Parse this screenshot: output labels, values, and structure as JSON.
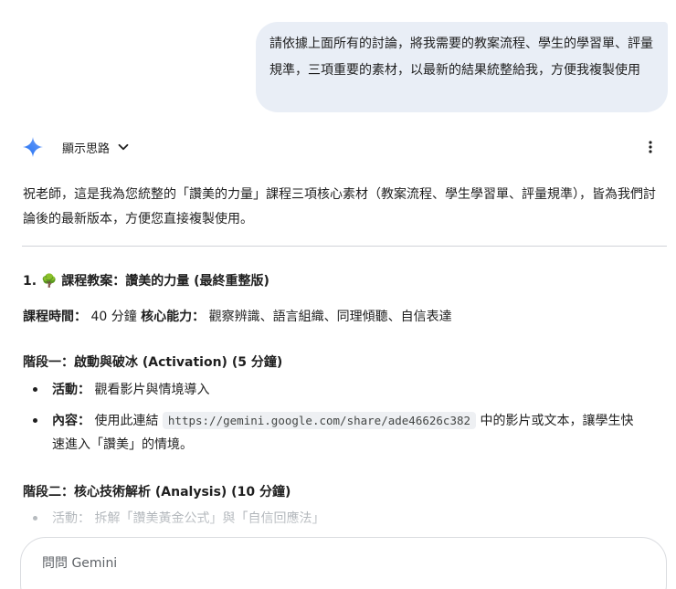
{
  "user_message": {
    "text": "請依據上面所有的討論，將我需要的教案流程、學生的學習單、評量規準，三項重要的素材，以最新的結果統整給我，方便我複製使用"
  },
  "response_header": {
    "show_thinking_label": "顯示思路",
    "avatar_icon": "gemini-spark-icon",
    "more_icon": "more-vert-icon"
  },
  "response": {
    "intro": "祝老師，這是我為您統整的「讚美的力量」課程三項核心素材（教案流程、學生學習單、評量規準），皆為我們討論後的最新版本，方便您直接複製使用。",
    "section1": {
      "number": "1.",
      "icon": "🌳",
      "title": "課程教案：讚美的力量 (最終重整版)"
    },
    "meta": {
      "time_label": "課程時間：",
      "time_value": "40 分鐘",
      "ability_label": "核心能力：",
      "ability_value": "觀察辨識、語言組織、同理傾聽、自信表達"
    },
    "stage1": {
      "title": "階段一：啟動與破冰 (Activation) (5 分鐘)",
      "items": [
        {
          "label": "活動：",
          "text": "觀看影片與情境導入"
        },
        {
          "label": "內容：",
          "text_before": "使用此連結",
          "link": "https://gemini.google.com/share/ade46626c382",
          "text_after_line1": "中的影片或文本，讓學生快",
          "text_after_line2": "速進入「讚美」的情境。"
        }
      ]
    },
    "stage2": {
      "title": "階段二：核心技術解析 (Analysis) (10 分鐘)",
      "items": [
        {
          "label": "活動：",
          "text": "拆解「讚美黃金公式」與「自信回應法」"
        }
      ]
    }
  },
  "input": {
    "placeholder": "問問 Gemini"
  }
}
